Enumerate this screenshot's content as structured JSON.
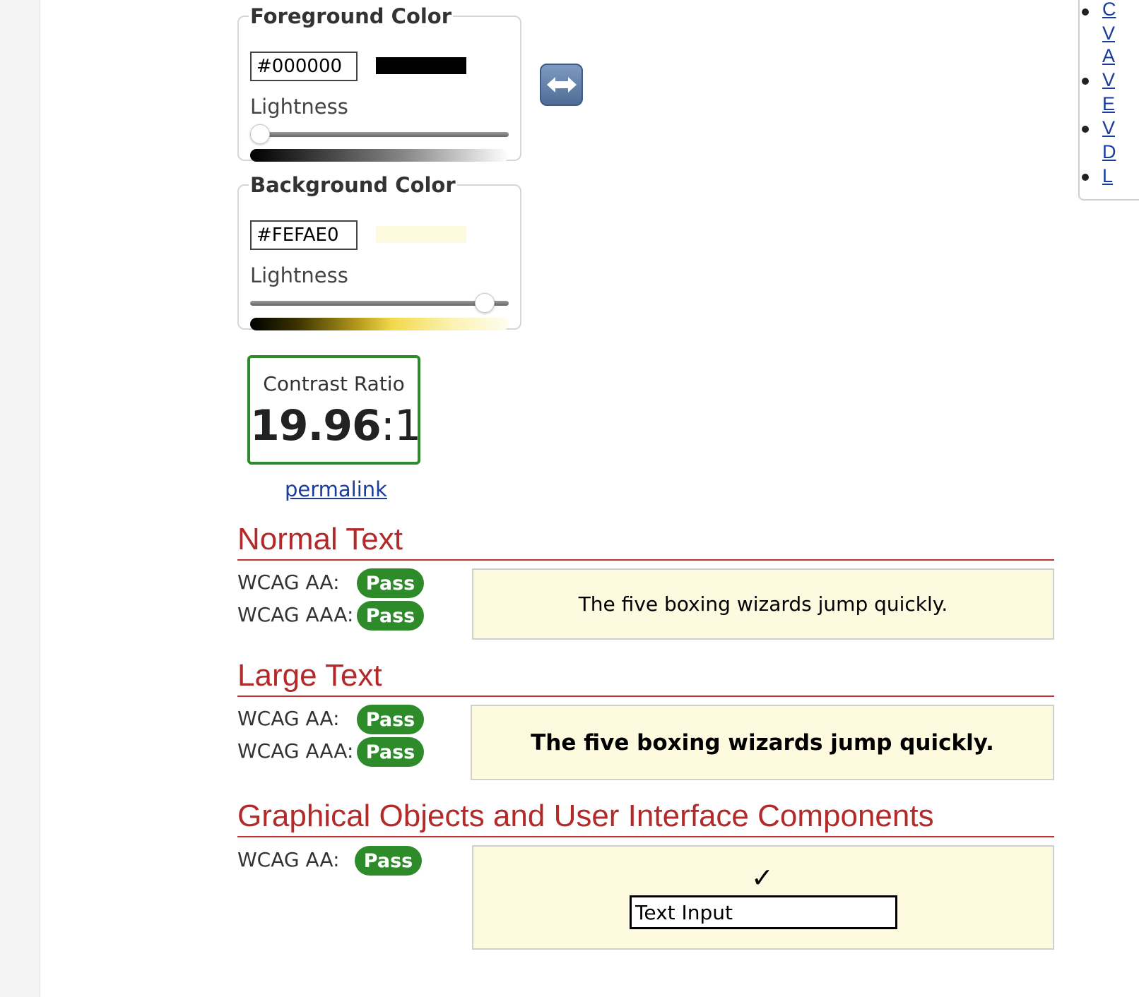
{
  "foreground": {
    "legend": "Foreground Color",
    "hex_value": "#000000",
    "swatch_color": "#000000",
    "lightness_label": "Lightness",
    "lightness_percent": 0
  },
  "background": {
    "legend": "Background Color",
    "hex_value": "#FEFAE0",
    "swatch_color": "#FEFAE0",
    "lightness_label": "Lightness",
    "lightness_percent": 94
  },
  "swap_icon": "left-right-arrow-icon",
  "contrast": {
    "label": "Contrast Ratio",
    "ratio_main": "19.96",
    "ratio_suffix": ":1"
  },
  "permalink_label": "permalink",
  "normal_text": {
    "heading": "Normal Text",
    "aa_label": "WCAG AA:",
    "aa_result": "Pass",
    "aaa_label": "WCAG AAA:",
    "aaa_result": "Pass",
    "sample": "The five boxing wizards jump quickly."
  },
  "large_text": {
    "heading": "Large Text",
    "aa_label": "WCAG AA:",
    "aa_result": "Pass",
    "aaa_label": "WCAG AAA:",
    "aaa_result": "Pass",
    "sample": "The five boxing wizards jump quickly."
  },
  "graphical": {
    "heading": "Graphical Objects and User Interface Components",
    "aa_label": "WCAG AA:",
    "aa_result": "Pass",
    "checkmark": "✓",
    "input_value": "Text Input"
  },
  "sidebar_fragments": [
    "C",
    "V",
    "A",
    "V",
    "E",
    "V",
    "D",
    "L"
  ],
  "colors": {
    "pass_green": "#2e8b2a",
    "heading_red": "#b22a2a",
    "link_blue": "#1a3c9c",
    "sample_bg": "#FEFAE0"
  }
}
